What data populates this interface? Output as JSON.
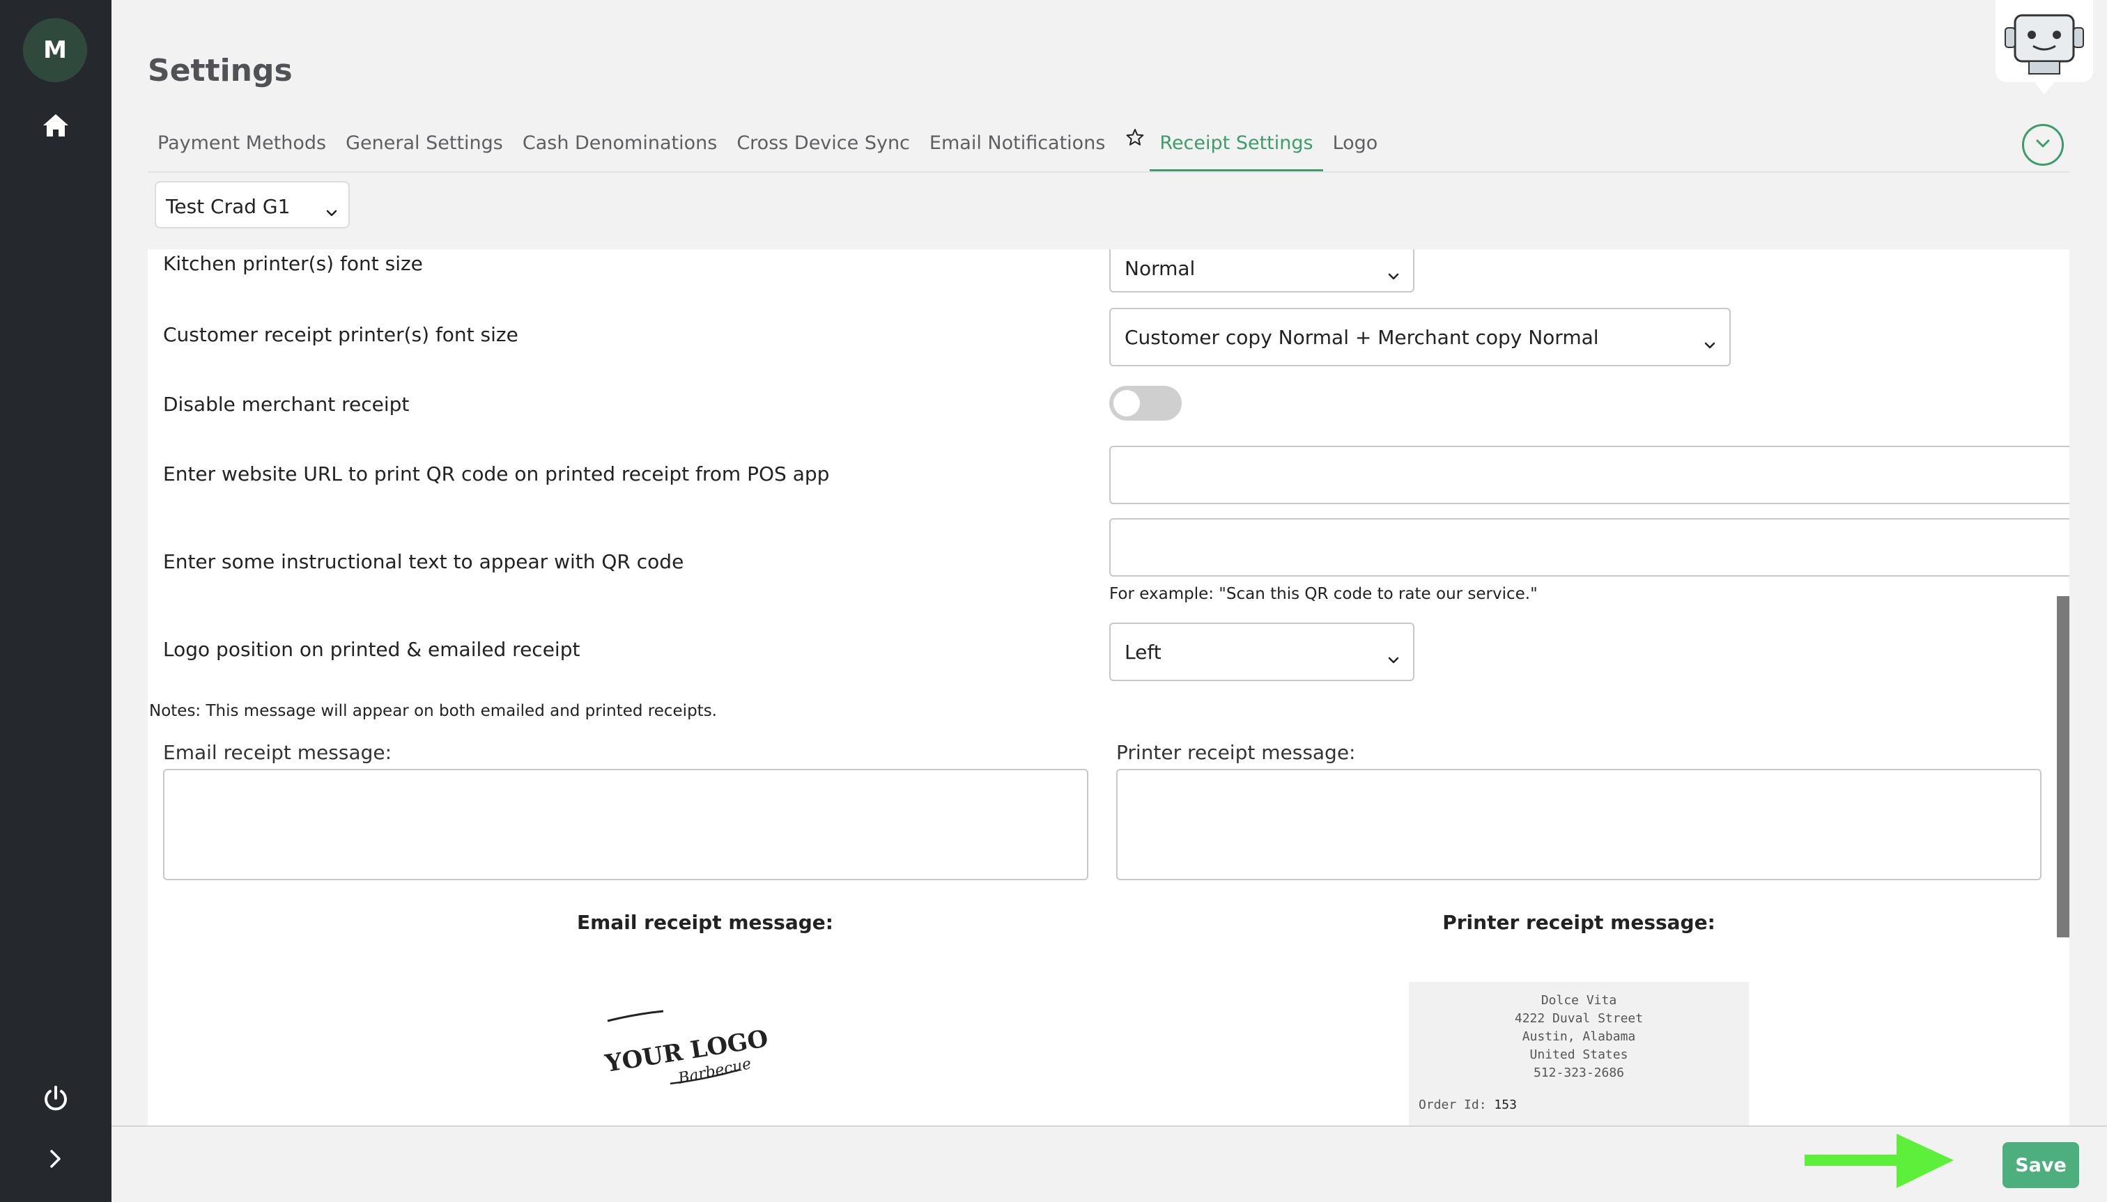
{
  "sidebar": {
    "avatar_initial": "M",
    "icons": [
      "home-icon",
      "power-icon",
      "chevron-right-icon"
    ]
  },
  "page": {
    "title": "Settings"
  },
  "tabs": [
    {
      "label": "Payment Methods",
      "active": false
    },
    {
      "label": "General Settings",
      "active": false
    },
    {
      "label": "Cash Denominations",
      "active": false
    },
    {
      "label": "Cross Device Sync",
      "active": false
    },
    {
      "label": "Email Notifications",
      "active": false
    },
    {
      "label": "Receipt Settings",
      "active": true,
      "icon": "star-icon"
    },
    {
      "label": "Logo",
      "active": false
    }
  ],
  "device_selector": {
    "value": "Test Crad G1"
  },
  "settings": {
    "kitchen_font": {
      "label": "Kitchen printer(s) font size",
      "value": "Normal"
    },
    "customer_font": {
      "label": "Customer receipt printer(s) font size",
      "value": "Customer copy Normal + Merchant copy Normal"
    },
    "disable_merchant": {
      "label": "Disable merchant receipt",
      "enabled": false
    },
    "qr_url": {
      "label": "Enter website URL to print QR code on printed receipt from POS app",
      "value": ""
    },
    "qr_text": {
      "label": "Enter some instructional text to appear with QR code",
      "value": "",
      "hint": "For example: \"Scan this QR code to rate our service.\""
    },
    "logo_position": {
      "label": "Logo position on printed & emailed receipt",
      "value": "Left"
    }
  },
  "messages": {
    "notes": "Notes: This message will appear on both emailed and printed receipts.",
    "email_label": "Email receipt message:",
    "printer_label": "Printer receipt message:",
    "email_value": "",
    "printer_value": ""
  },
  "preview": {
    "email_title": "Email receipt message:",
    "printer_title": "Printer receipt message:",
    "logo_text_1": "YOUR LOGO",
    "logo_text_2": "Barbecue",
    "receipt_lines": [
      "Dolce Vita",
      "4222 Duval Street",
      "Austin, Alabama",
      "United States",
      "512-323-2686"
    ],
    "order_id_label": "Order Id:",
    "order_id_value": "153"
  },
  "footer": {
    "save_label": "Save"
  },
  "colors": {
    "accent": "#3e9c6c",
    "sidebar": "#25292d",
    "save": "#4caf7d",
    "arrow": "#5cf03a"
  }
}
